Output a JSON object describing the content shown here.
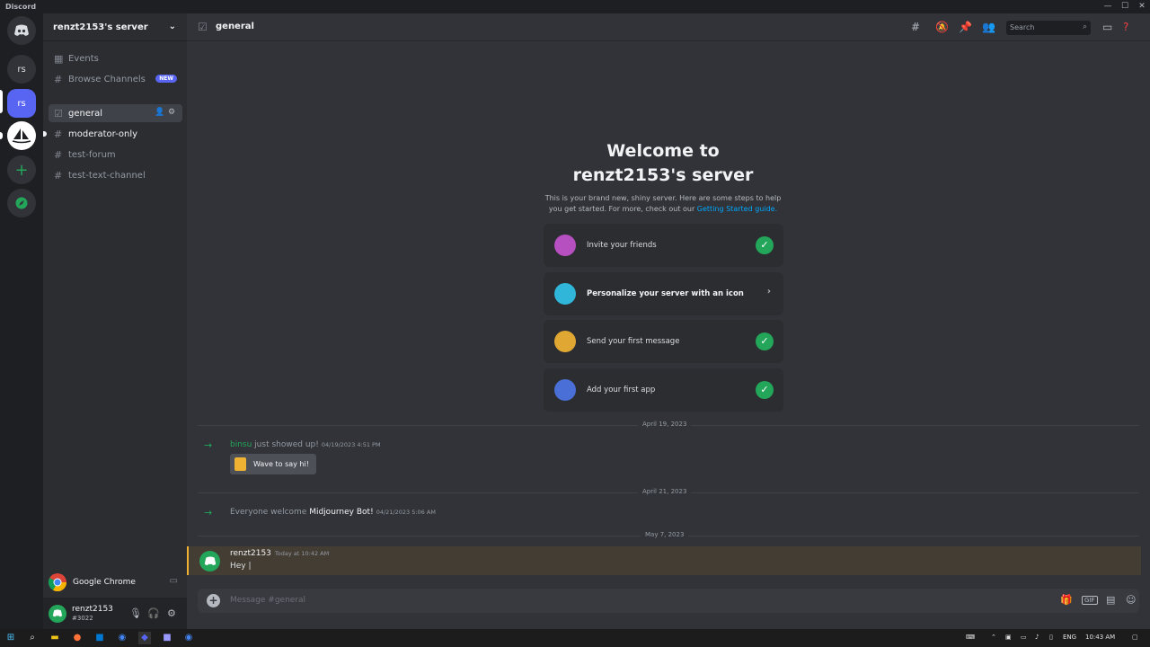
{
  "window": {
    "title": "Discord",
    "controls": [
      "—",
      "☐",
      "✕"
    ]
  },
  "guilds": {
    "home_icon": "discord-logo-icon",
    "servers": [
      {
        "label": "rs",
        "color": "#313338"
      },
      {
        "label": "rs",
        "color": "#5865f2"
      },
      {
        "label": "",
        "icon": "midjourney-sailboat-icon",
        "color": "#ffffff"
      }
    ],
    "add_label": "+",
    "explore_icon": "compass-icon"
  },
  "server": {
    "name": "renzt2153's server",
    "top_items": [
      {
        "label": "Events",
        "icon": "calendar-icon"
      },
      {
        "label": "Browse Channels",
        "icon": "browse-channels-icon",
        "badge": "NEW"
      }
    ],
    "channels": [
      {
        "label": "general",
        "icon": "rules-channel-icon",
        "active": true
      },
      {
        "label": "moderator-only",
        "icon": "hash-icon",
        "unread": true
      },
      {
        "label": "test-forum",
        "icon": "hash-icon"
      },
      {
        "label": "test-text-channel",
        "icon": "hash-icon"
      }
    ]
  },
  "activity": {
    "label": "Google Chrome"
  },
  "user": {
    "name": "renzt2153",
    "tag": "#3022"
  },
  "channel_header": {
    "title": "general",
    "search_placeholder": "Search"
  },
  "welcome": {
    "line1": "Welcome to",
    "line2": "renzt2153's server",
    "subtitle": "This is your brand new, shiny server. Here are some steps to help you get started. For more, check out our",
    "link": "Getting Started guide.",
    "steps": [
      {
        "label": "Invite your friends",
        "done": true,
        "color": "#b64fc0"
      },
      {
        "label": "Personalize your server with an icon",
        "done": false,
        "color": "#2fb6d8"
      },
      {
        "label": "Send your first message",
        "done": true,
        "color": "#e0a732"
      },
      {
        "label": "Add your first app",
        "done": true,
        "color": "#4a6fd6"
      }
    ]
  },
  "messages": {
    "date1": "April 19, 2023",
    "join1": {
      "name": "binsu",
      "text": " just showed up!",
      "time": "04/19/2023 4:51 PM"
    },
    "wave_label": "Wave to say hi!",
    "date2": "April 21, 2023",
    "join2": {
      "prefix": "Everyone welcome ",
      "name": "Midjourney Bot",
      "suffix": "!",
      "time": "04/21/2023 5:06 AM"
    },
    "date3": "May 7, 2023",
    "msg": {
      "author": "renzt2153",
      "time": "Today at 10:42 AM",
      "text": "Hey |"
    }
  },
  "composer": {
    "placeholder": "Message #general"
  },
  "taskbar": {
    "lang": "ENG",
    "time": "10:43 AM"
  }
}
